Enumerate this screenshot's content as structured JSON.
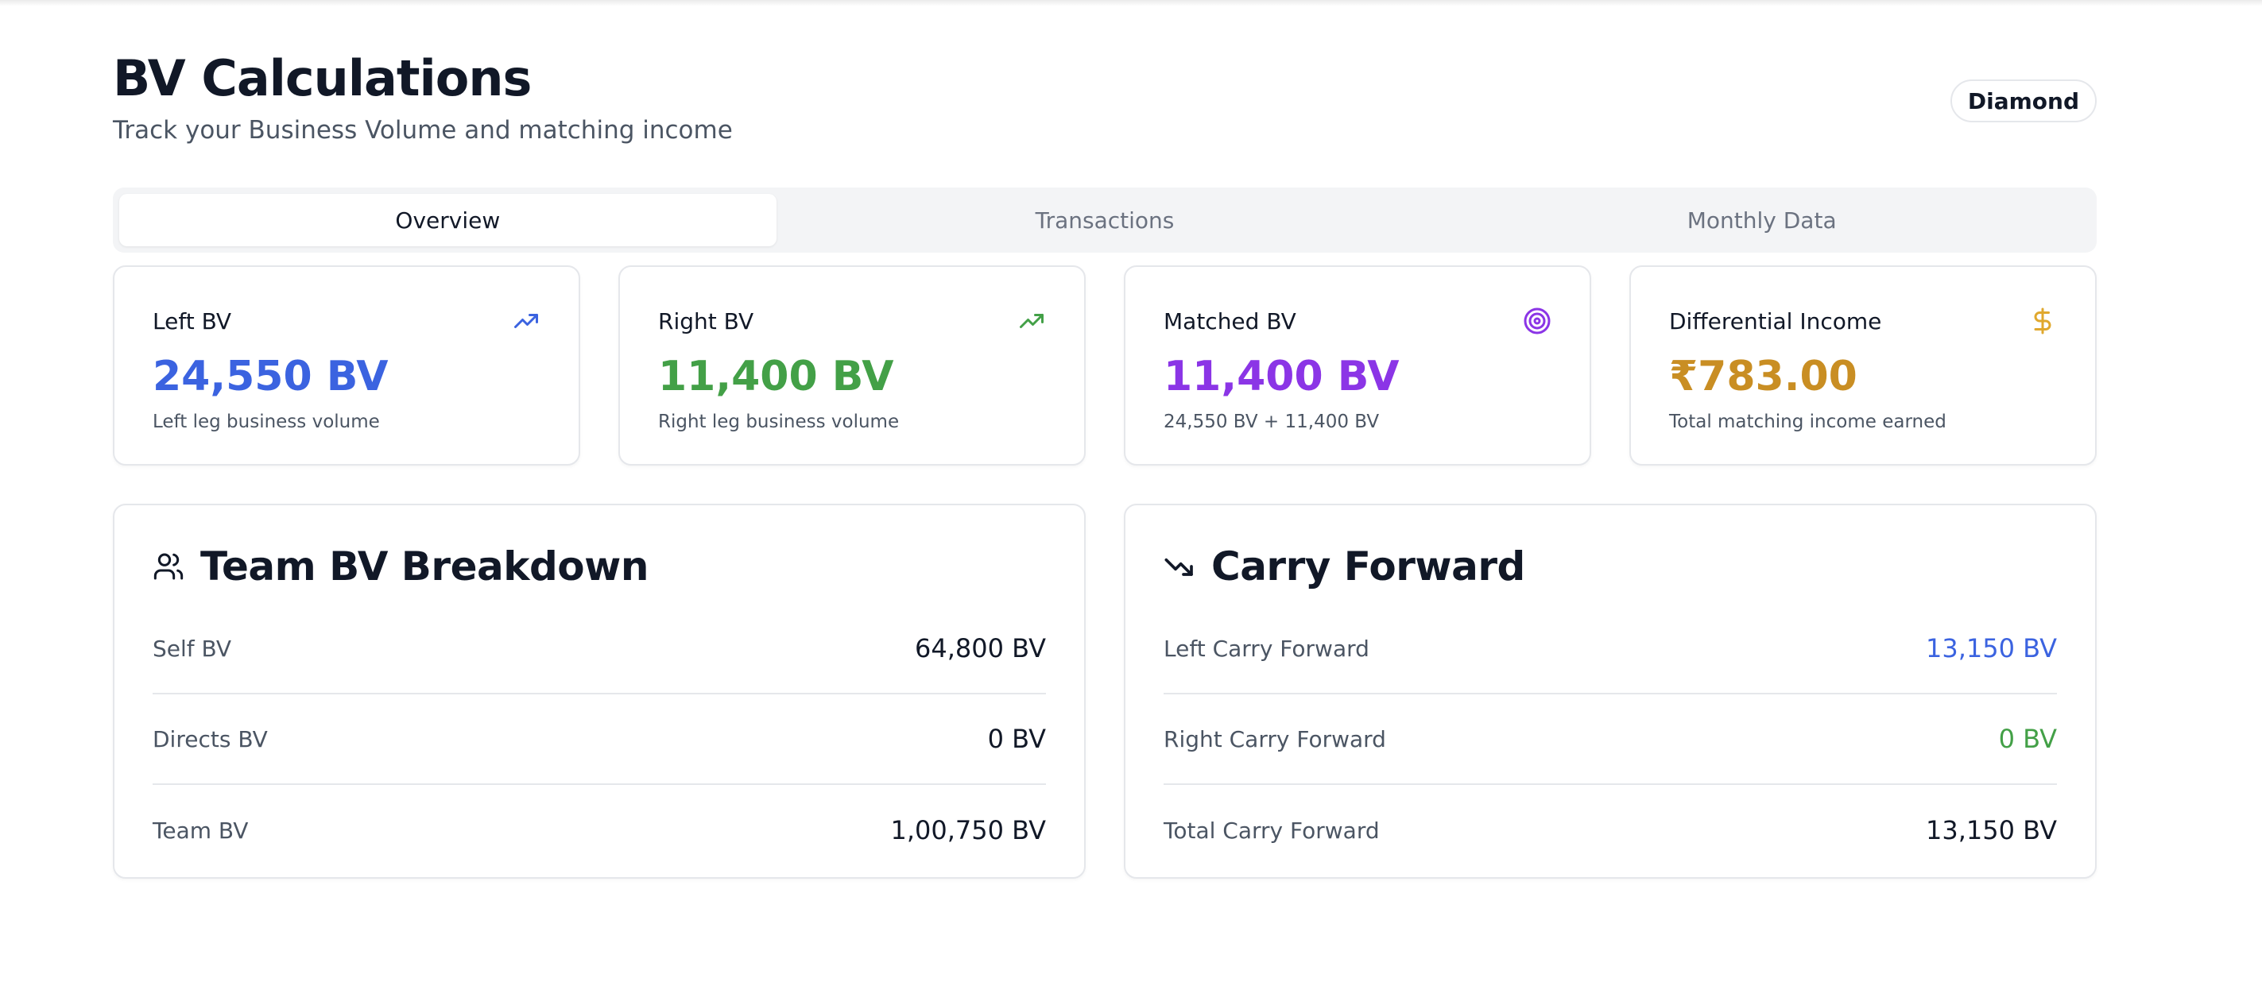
{
  "header": {
    "title": "BV Calculations",
    "subtitle": "Track your Business Volume and matching income",
    "rank_badge": "Diamond"
  },
  "tabs": [
    {
      "label": "Overview",
      "active": true
    },
    {
      "label": "Transactions",
      "active": false
    },
    {
      "label": "Monthly Data",
      "active": false
    }
  ],
  "stats": [
    {
      "label": "Left BV",
      "value": "24,550 BV",
      "description": "Left leg business volume",
      "icon": "trending-up-icon",
      "color": "#3b63e0"
    },
    {
      "label": "Right BV",
      "value": "11,400 BV",
      "description": "Right leg business volume",
      "icon": "trending-up-icon",
      "color": "#43a047"
    },
    {
      "label": "Matched BV",
      "value": "11,400 BV",
      "description": "24,550 BV + 11,400 BV",
      "icon": "target-icon",
      "color": "#8b35e6"
    },
    {
      "label": "Differential Income",
      "value": "₹783.00",
      "description": "Total matching income earned",
      "icon": "dollar-icon",
      "color": "#c98e23"
    }
  ],
  "team_breakdown": {
    "title": "Team BV Breakdown",
    "icon": "users-icon",
    "rows": [
      {
        "label": "Self BV",
        "value": "64,800 BV"
      },
      {
        "label": "Directs BV",
        "value": "0 BV"
      },
      {
        "label": "Team BV",
        "value": "1,00,750 BV"
      }
    ]
  },
  "carry_forward": {
    "title": "Carry Forward",
    "icon": "trending-down-icon",
    "rows": [
      {
        "label": "Left Carry Forward",
        "value": "13,150 BV",
        "color": "#3b63e0"
      },
      {
        "label": "Right Carry Forward",
        "value": "0 BV",
        "color": "#43a047"
      },
      {
        "label": "Total Carry Forward",
        "value": "13,150 BV",
        "color": "#111827"
      }
    ]
  }
}
